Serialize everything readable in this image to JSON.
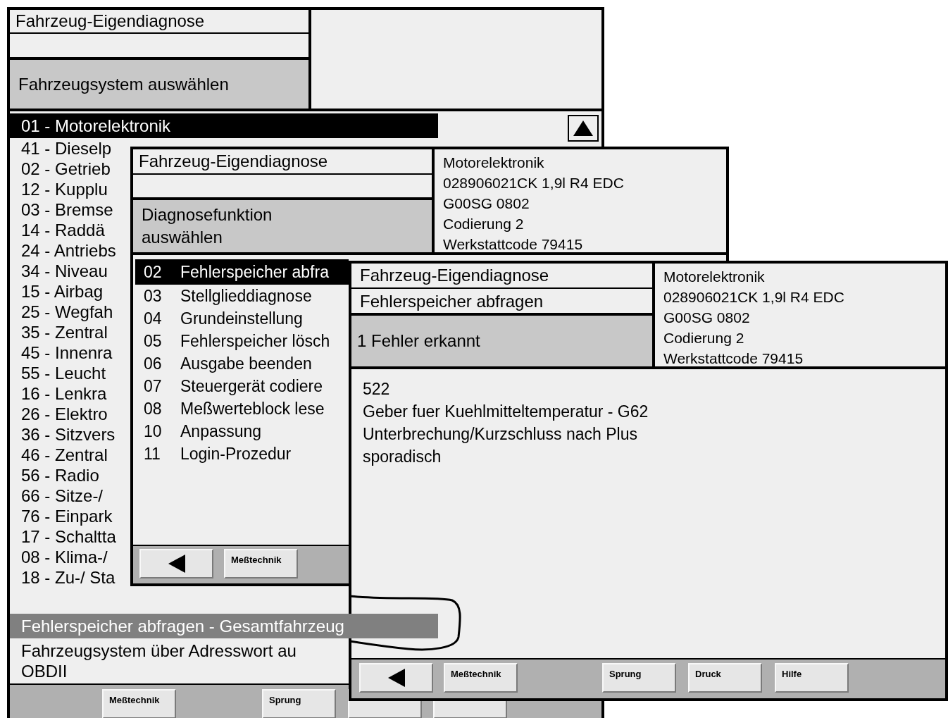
{
  "system_window": {
    "title": "Fahrzeug-Eigendiagnose",
    "heading": "Fahrzeugsystem auswählen",
    "systems": [
      {
        "label": "01 - Motorelektronik",
        "selected": true
      },
      {
        "label": "41 - Dieselp",
        "selected": false
      },
      {
        "label": "02 - Getrieb",
        "selected": false
      },
      {
        "label": "12 - Kupplu",
        "selected": false
      },
      {
        "label": "03 - Bremse",
        "selected": false
      },
      {
        "label": "14 - Raddä",
        "selected": false
      },
      {
        "label": "24 - Antriebs",
        "selected": false
      },
      {
        "label": "34 - Niveau",
        "selected": false
      },
      {
        "label": "15 - Airbag",
        "selected": false
      },
      {
        "label": "25 - Wegfah",
        "selected": false
      },
      {
        "label": "35 - Zentral",
        "selected": false
      },
      {
        "label": "45 - Innenra",
        "selected": false
      },
      {
        "label": "55 - Leucht",
        "selected": false
      },
      {
        "label": "16 - Lenkra",
        "selected": false
      },
      {
        "label": "26 - Elektro",
        "selected": false
      },
      {
        "label": "36 - Sitzvers",
        "selected": false
      },
      {
        "label": "46 - Zentral",
        "selected": false
      },
      {
        "label": "56 - Radio",
        "selected": false
      },
      {
        "label": "66 - Sitze-/",
        "selected": false
      },
      {
        "label": "76 - Einpark",
        "selected": false
      },
      {
        "label": "17 - Schaltta",
        "selected": false
      },
      {
        "label": "08 - Klima-/",
        "selected": false
      },
      {
        "label": "18 - Zu-/ Sta",
        "selected": false
      }
    ],
    "functions": [
      {
        "label": "Fehlerspeicher abfragen - Gesamtfahrzeug",
        "selected": true
      },
      {
        "label": "Fahrzeugsystem über Adresswort au",
        "selected": false
      },
      {
        "label": "OBDII",
        "selected": false
      }
    ],
    "buttons": [
      {
        "kind": "text",
        "label": "Meßtechnik"
      },
      {
        "kind": "text",
        "label": "Sprung"
      },
      {
        "kind": "covered"
      },
      {
        "kind": "covered"
      }
    ]
  },
  "function_window": {
    "title": "Fahrzeug-Eigendiagnose",
    "heading": "Diagnosefunktion auswählen",
    "info": [
      "Motorelektronik",
      "028906021CK 1,9l R4 EDC",
      "G00SG 0802",
      "Codierung 2",
      "Werkstattcode 79415"
    ],
    "functions": [
      {
        "code": "02",
        "label": "Fehlerspeicher abfra",
        "selected": true
      },
      {
        "code": "03",
        "label": "Stellglieddiagnose",
        "selected": false
      },
      {
        "code": "04",
        "label": "Grundeinstellung",
        "selected": false
      },
      {
        "code": "05",
        "label": "Fehlerspeicher lösch",
        "selected": false
      },
      {
        "code": "06",
        "label": "Ausgabe beenden",
        "selected": false
      },
      {
        "code": "07",
        "label": "Steuergerät codiere",
        "selected": false
      },
      {
        "code": "08",
        "label": "Meßwerteblock lese",
        "selected": false
      },
      {
        "code": "10",
        "label": "Anpassung",
        "selected": false
      },
      {
        "code": "11",
        "label": "Login-Prozedur",
        "selected": false
      }
    ],
    "buttons": [
      {
        "kind": "back"
      },
      {
        "kind": "text",
        "label": "Meßtechnik"
      }
    ]
  },
  "fault_window": {
    "title": "Fahrzeug-Eigendiagnose",
    "subtitle": "Fehlerspeicher abfragen",
    "heading": "1 Fehler erkannt",
    "info": [
      "Motorelektronik",
      "028906021CK 1,9l R4 EDC",
      "G00SG 0802",
      "Codierung 2",
      "Werkstattcode 79415"
    ],
    "fault_lines": [
      "522",
      "Geber fuer Kuehlmitteltemperatur - G62",
      "Unterbrechung/Kurzschluss nach Plus",
      "sporadisch"
    ],
    "buttons": [
      {
        "kind": "back"
      },
      {
        "kind": "text",
        "label": "Meßtechnik"
      },
      {
        "kind": "text",
        "label": "Sprung"
      },
      {
        "kind": "text",
        "label": "Druck"
      },
      {
        "kind": "text",
        "label": "Hilfe"
      }
    ]
  }
}
